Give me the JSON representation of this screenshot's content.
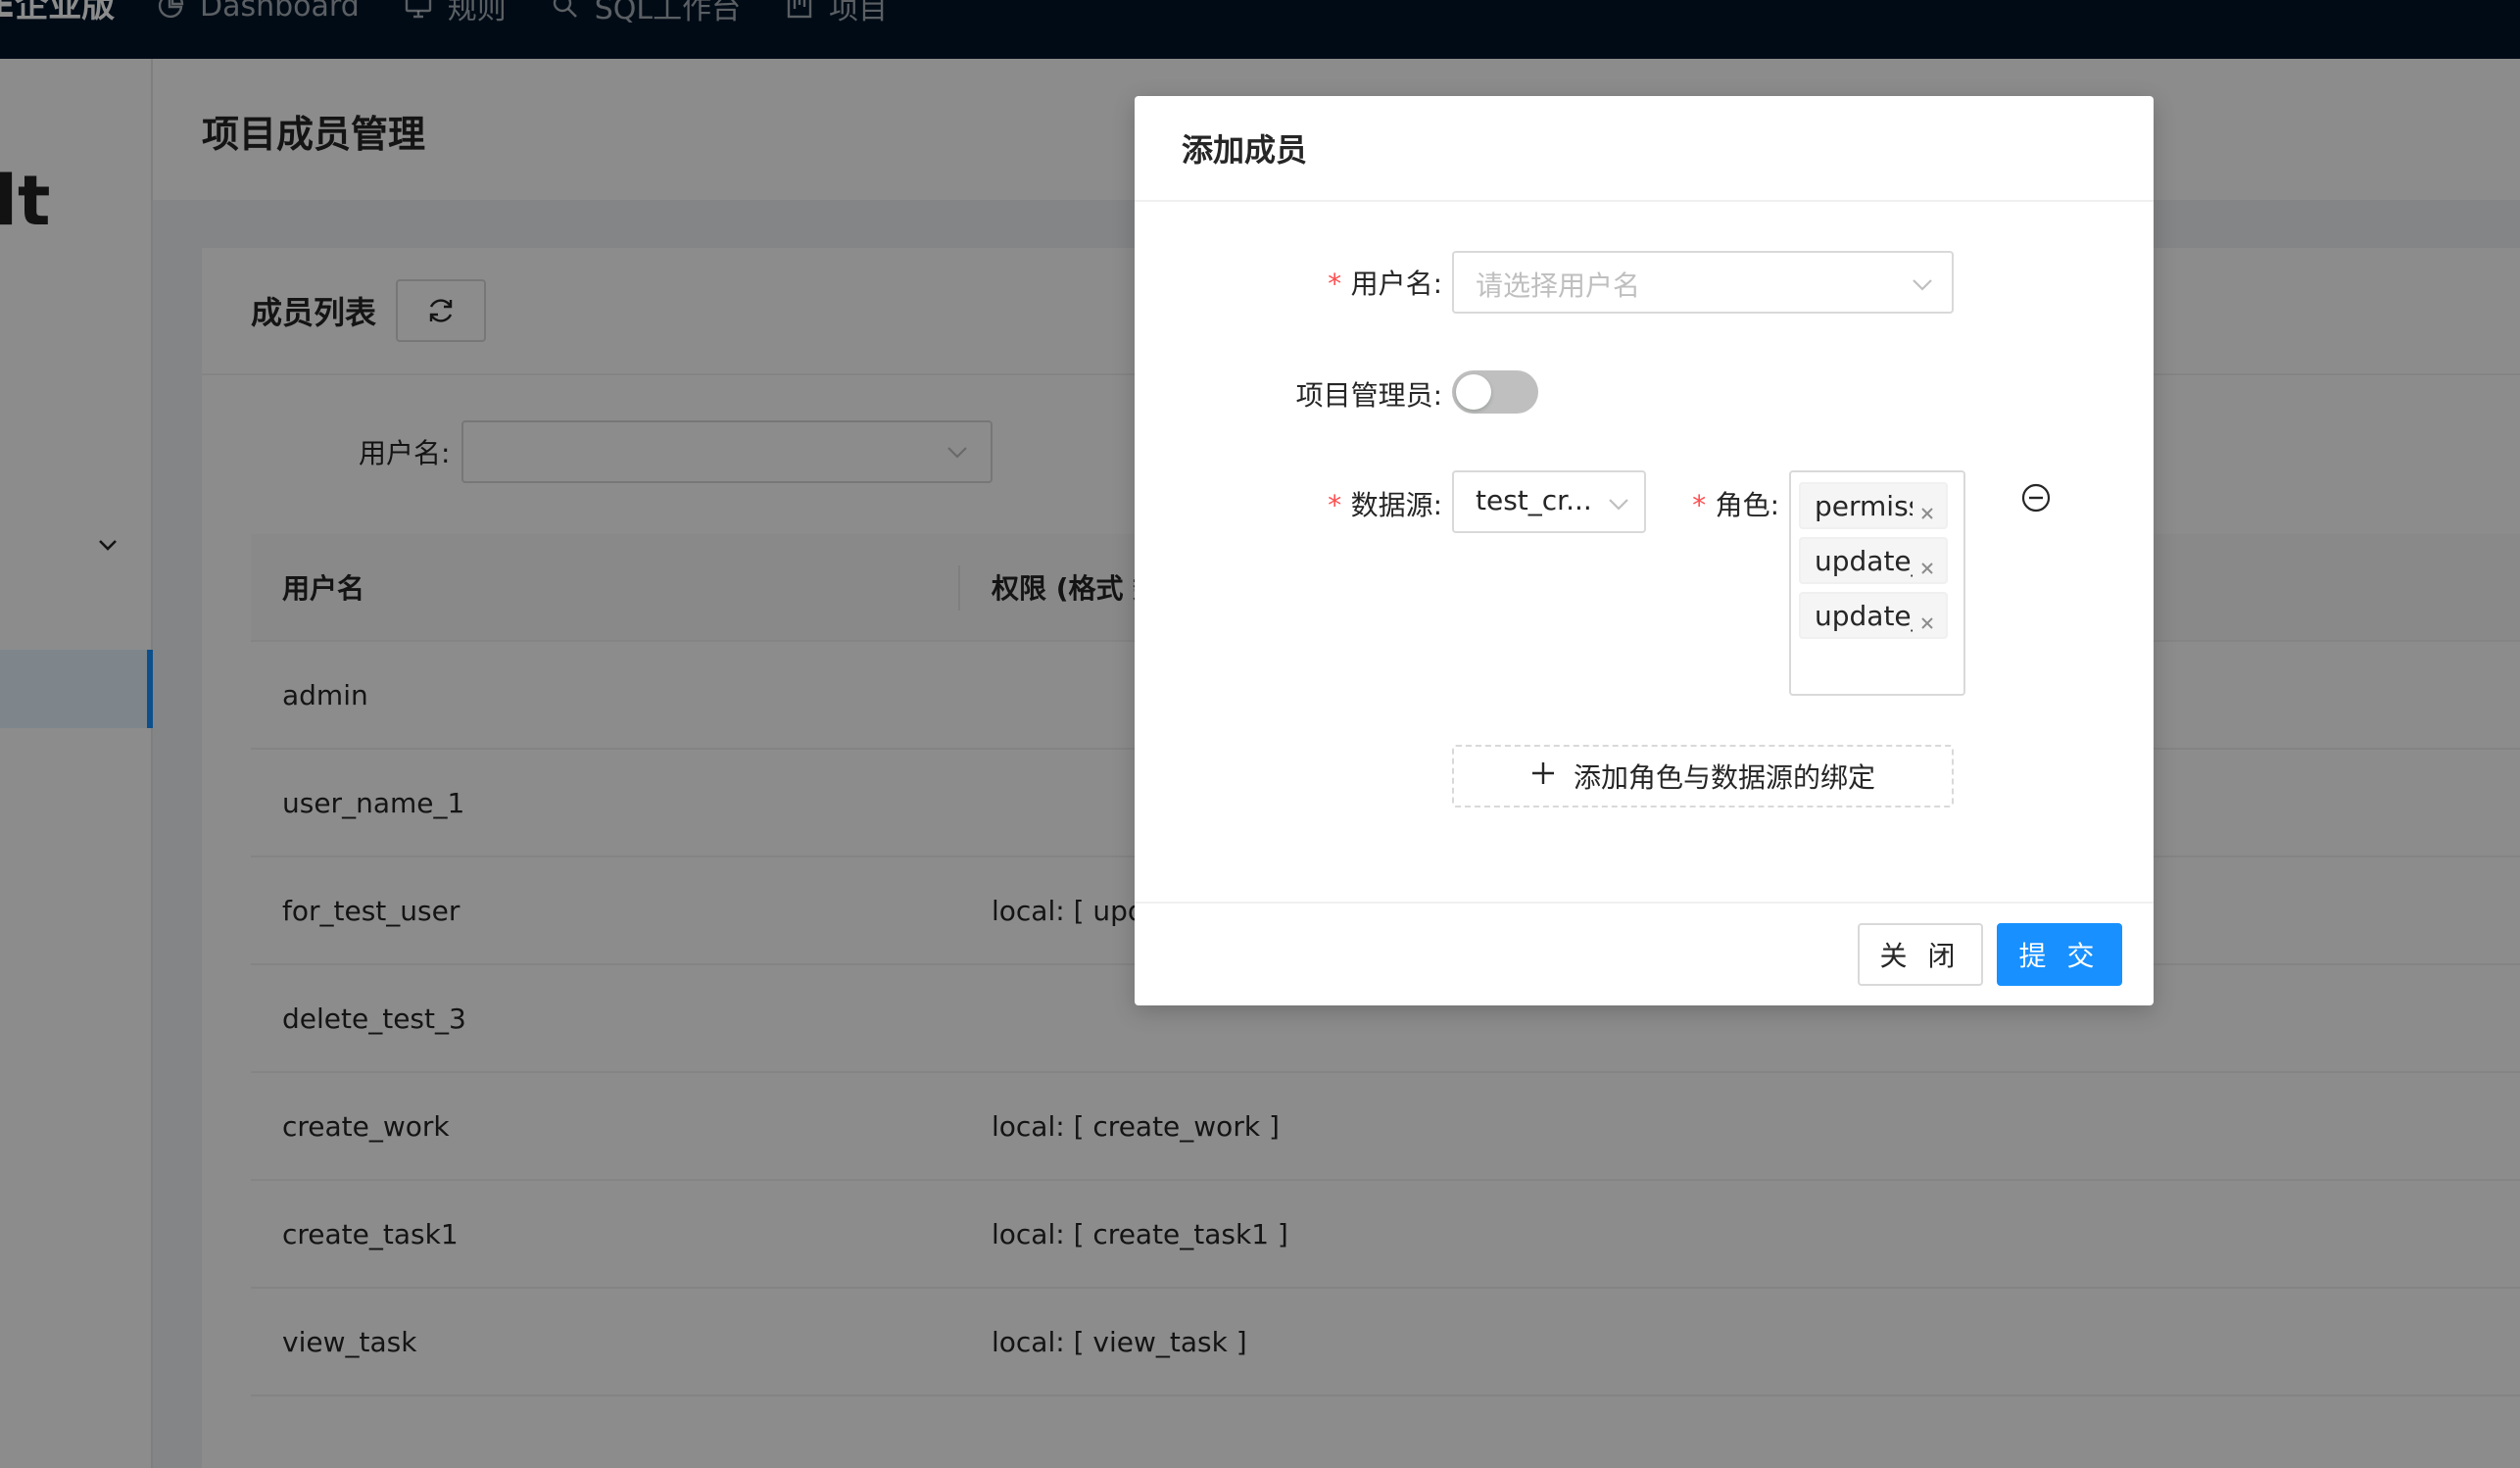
{
  "topbar": {
    "brand": "E企业版",
    "menu": [
      {
        "label": "Dashboard",
        "icon": "pie-chart-icon"
      },
      {
        "label": "规则",
        "icon": "desktop-icon"
      },
      {
        "label": "SQL工作台",
        "icon": "search-icon"
      },
      {
        "label": "项目",
        "icon": "project-icon"
      }
    ]
  },
  "sidebar": {
    "logo_fragment": "lt"
  },
  "page": {
    "title": "项目成员管理",
    "card_title": "成员列表",
    "filter": {
      "label": "用户名:"
    },
    "table": {
      "columns": [
        "用户名",
        "权限 (格式 数"
      ],
      "rows": [
        {
          "user": "admin",
          "perm": ""
        },
        {
          "user": "user_name_1",
          "perm": ""
        },
        {
          "user": "for_test_user",
          "perm": "local: [ upd"
        },
        {
          "user": "delete_test_3",
          "perm": ""
        },
        {
          "user": "create_work",
          "perm": "local: [ create_work ]"
        },
        {
          "user": "create_task1",
          "perm": "local: [ create_task1 ]"
        },
        {
          "user": "view_task",
          "perm": "local: [ view_task ]"
        }
      ]
    }
  },
  "modal": {
    "title": "添加成员",
    "username_label": "用户名:",
    "username_placeholder": "请选择用户名",
    "admin_label": "项目管理员:",
    "admin_enabled": false,
    "datasource_label": "数据源:",
    "datasource_value": "test_cr...",
    "role_label": "角色:",
    "role_tags": [
      "permiss",
      "update_",
      "update_"
    ],
    "add_binding_label": "添加角色与数据源的绑定",
    "close_label": "关 闭",
    "submit_label": "提 交",
    "colors": {
      "primary": "#1890ff",
      "required": "#ff4d4f"
    }
  }
}
